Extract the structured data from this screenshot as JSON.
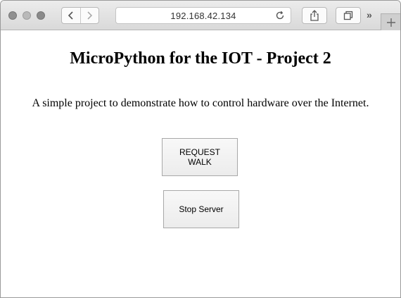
{
  "browser": {
    "url": "192.168.42.134",
    "more_symbol": "»"
  },
  "page": {
    "title": "MicroPython for the IOT - Project 2",
    "description": "A simple project to demonstrate how to control hardware over the Internet.",
    "buttons": {
      "request_walk": "REQUEST WALK",
      "stop_server": "Stop Server"
    }
  }
}
